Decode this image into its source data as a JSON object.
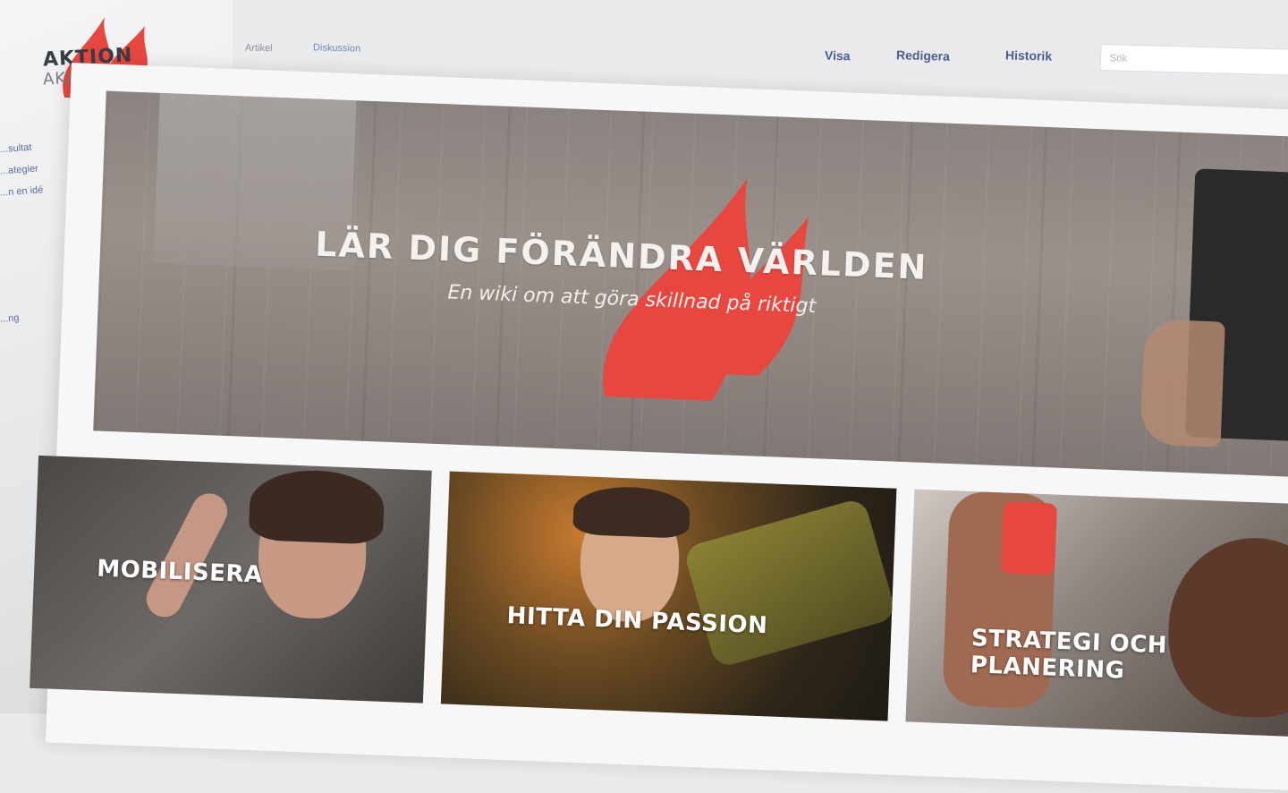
{
  "brand": {
    "logo_main": "AKTION",
    "logo_sub": "AKADEMY"
  },
  "sidebar": {
    "links": [
      "...sultat",
      "...ategier",
      "...n en idé",
      "...ng"
    ]
  },
  "nav": {
    "left_tabs": [
      "Artikel",
      "Diskussion"
    ],
    "right_tabs": [
      "Visa",
      "Redigera",
      "Historik"
    ],
    "search_placeholder": "Sök"
  },
  "hero": {
    "title": "LÄR DIG FÖRÄNDRA VÄRLDEN",
    "subtitle": "En wiki om att göra skillnad på riktigt"
  },
  "cards": [
    {
      "label": "MOBILISERA"
    },
    {
      "label": "HITTA DIN PASSION"
    },
    {
      "label": "STRATEGI OCH PLANERING"
    }
  ],
  "colors": {
    "flame": "#e8473f",
    "nav_link": "#4b5f92"
  }
}
